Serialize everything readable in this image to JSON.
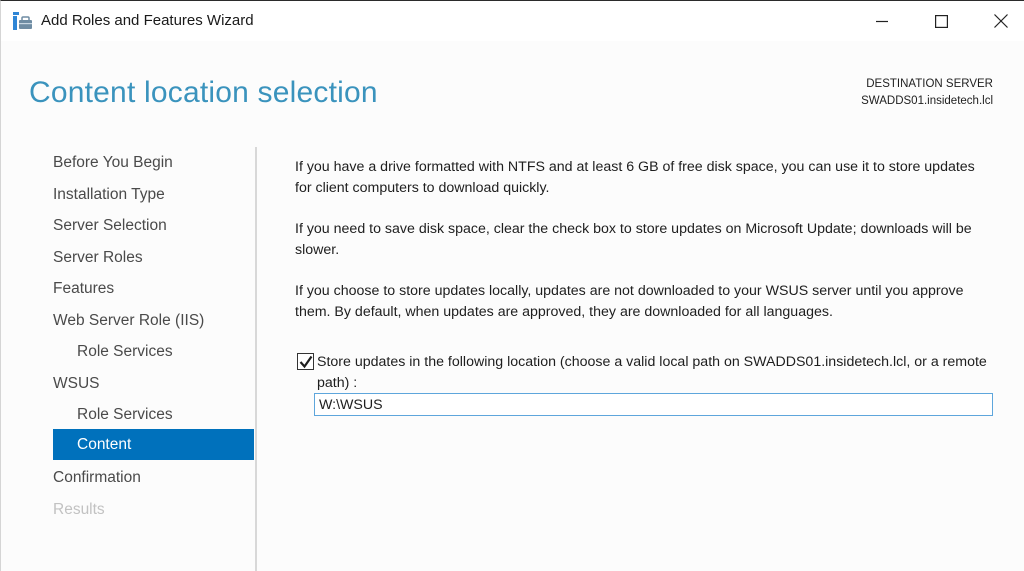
{
  "window": {
    "title": "Add Roles and Features Wizard",
    "app_icon": "server-manager-icon",
    "controls": {
      "minimize": "minimize-icon",
      "maximize": "maximize-icon",
      "close": "close-icon"
    }
  },
  "header": {
    "page_title": "Content location selection",
    "destination_label": "DESTINATION SERVER",
    "destination_server": "SWADDS01.insidetech.lcl"
  },
  "nav": {
    "items": [
      {
        "label": "Before You Begin",
        "level": 0,
        "state": "normal"
      },
      {
        "label": "Installation Type",
        "level": 0,
        "state": "normal"
      },
      {
        "label": "Server Selection",
        "level": 0,
        "state": "normal"
      },
      {
        "label": "Server Roles",
        "level": 0,
        "state": "normal"
      },
      {
        "label": "Features",
        "level": 0,
        "state": "normal"
      },
      {
        "label": "Web Server Role (IIS)",
        "level": 0,
        "state": "normal"
      },
      {
        "label": "Role Services",
        "level": 1,
        "state": "normal"
      },
      {
        "label": "WSUS",
        "level": 0,
        "state": "normal"
      },
      {
        "label": "Role Services",
        "level": 1,
        "state": "normal"
      },
      {
        "label": "Content",
        "level": 1,
        "state": "active"
      },
      {
        "label": "Confirmation",
        "level": 0,
        "state": "normal"
      },
      {
        "label": "Results",
        "level": 0,
        "state": "disabled"
      }
    ]
  },
  "content": {
    "paragraphs": [
      "If you have a drive formatted with NTFS and at least 6 GB of free disk space, you can use it to store updates for client computers to download quickly.",
      "If you need to save disk space, clear the check box to store updates on Microsoft Update; downloads will be slower.",
      "If you choose to store updates locally, updates are not downloaded to your WSUS server until you approve them. By default, when updates are approved, they are downloaded for all languages."
    ],
    "store_checkbox": {
      "checked": true,
      "label": "Store updates in the following location (choose a valid local path on SWADDS01.insidetech.lcl, or a remote path) :"
    },
    "path_input": {
      "value": "W:\\WSUS"
    }
  },
  "colors": {
    "title_accent": "#3a93bd",
    "nav_active_bg": "#0071bc",
    "nav_text": "#4a4a4a",
    "nav_disabled": "#c2c2c2",
    "input_border_focus": "#5ea6dc"
  }
}
